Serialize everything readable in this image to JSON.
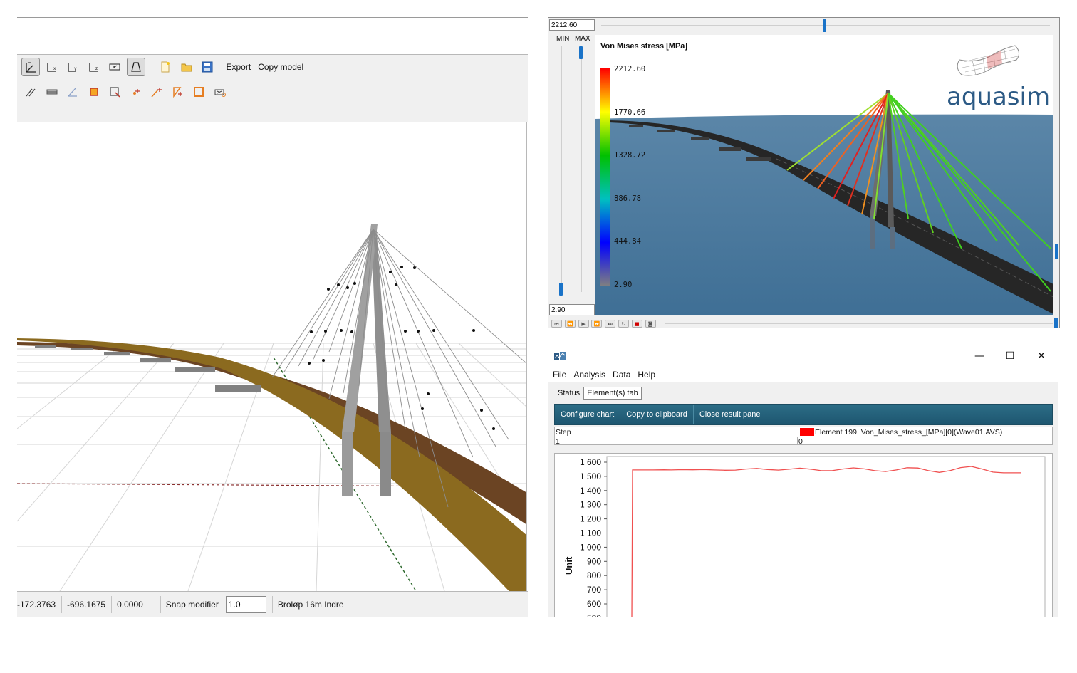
{
  "modeler": {
    "toolbar": {
      "row1_icons": [
        "view-3d-icon",
        "view-x-icon",
        "view-y-icon",
        "view-z-icon",
        "view-fit-icon",
        "perspective-icon",
        "new-file-icon",
        "open-folder-icon",
        "save-icon"
      ],
      "export_label": "Export",
      "copy_model_label": "Copy model",
      "row2_icons": [
        "line-tool-icon",
        "beam-tool-icon",
        "angle-tool-icon",
        "node-box-icon",
        "select-rect-icon",
        "add-node-icon",
        "add-line-icon",
        "add-element-icon",
        "box-select-icon",
        "camera-tool-icon"
      ]
    },
    "status": {
      "x": "-172.3763",
      "y": "-696.1675",
      "z": "0.0000",
      "snap_label": "Snap modifier",
      "snap_value": "1.0",
      "layer_name": "Broløp 16m Indre"
    }
  },
  "viewer": {
    "max_value": "2212.60",
    "min_value": "2.90",
    "min_label": "MIN",
    "max_label": "MAX",
    "legend_title": "Von Mises stress [MPa]",
    "legend_ticks": [
      "2212.60",
      "1770.66",
      "1328.72",
      "886.78",
      "444.84",
      "2.90"
    ],
    "logo_text": "aquasim",
    "playback_icons": [
      "first-frame-icon",
      "prev-frame-icon",
      "play-icon",
      "next-frame-icon",
      "last-frame-icon",
      "loop-icon",
      "stop-icon",
      "record-icon"
    ],
    "time_slider_position": 0.62
  },
  "chart_window": {
    "controls": {
      "minimize": "—",
      "maximize": "☐",
      "close": "✕"
    },
    "menu": [
      "File",
      "Analysis",
      "Data",
      "Help"
    ],
    "tabs": [
      "Status",
      "Element(s) tab"
    ],
    "actions": [
      "Configure chart",
      "Copy to clipboard",
      "Close result pane"
    ],
    "grid": {
      "step_header": "Step",
      "step_value": "1",
      "series_header": "Element 199, Von_Mises_stress_[MPa][0](Wave01.AVS)",
      "series_value": "0"
    }
  },
  "chart_data": {
    "type": "line",
    "ylabel": "Unit",
    "xlabel": "",
    "ylim": [
      500,
      1600
    ],
    "yticks": [
      "1 600",
      "1 500",
      "1 400",
      "1 300",
      "1 200",
      "1 100",
      "1 000",
      "900",
      "800",
      "700",
      "600",
      "500"
    ],
    "ytick_values": [
      1600,
      1500,
      1400,
      1300,
      1200,
      1100,
      1000,
      900,
      800,
      700,
      600,
      500
    ],
    "color": "#f05050",
    "series": [
      {
        "x": [
          0,
          1,
          5,
          15,
          30,
          45,
          55,
          70,
          85,
          100,
          115,
          130,
          145,
          160,
          175,
          190,
          205,
          220,
          235,
          250,
          265,
          280,
          295,
          310,
          325,
          340,
          355,
          370,
          385,
          400,
          415,
          430,
          445,
          460,
          475,
          490,
          505,
          520,
          545
        ],
        "values": [
          500,
          1545,
          1545,
          1545,
          1545,
          1546,
          1545,
          1547,
          1546,
          1548,
          1545,
          1543,
          1544,
          1552,
          1556,
          1548,
          1544,
          1550,
          1558,
          1551,
          1540,
          1540,
          1552,
          1560,
          1553,
          1540,
          1534,
          1545,
          1561,
          1559,
          1540,
          1528,
          1540,
          1562,
          1570,
          1552,
          1530,
          1525,
          1525
        ]
      }
    ]
  }
}
